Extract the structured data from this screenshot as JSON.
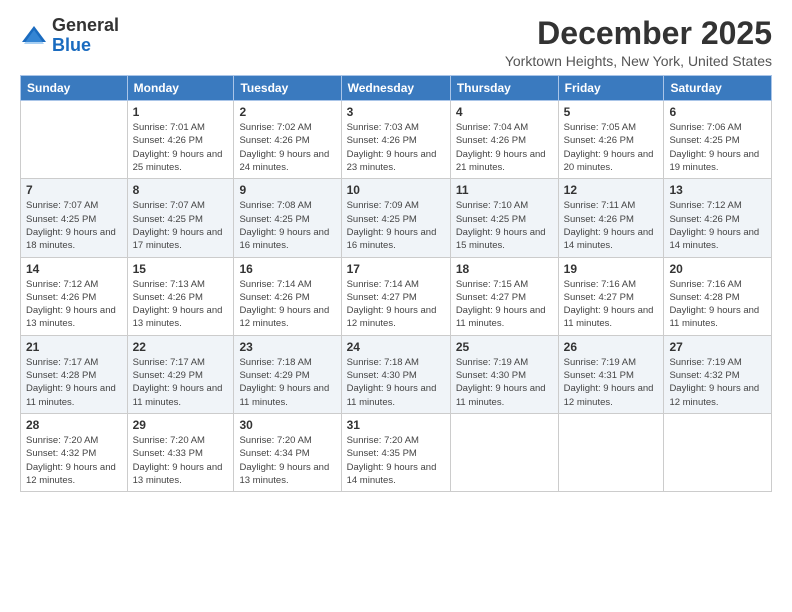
{
  "logo": {
    "general": "General",
    "blue": "Blue"
  },
  "title": "December 2025",
  "subtitle": "Yorktown Heights, New York, United States",
  "weekdays": [
    "Sunday",
    "Monday",
    "Tuesday",
    "Wednesday",
    "Thursday",
    "Friday",
    "Saturday"
  ],
  "weeks": [
    [
      {
        "day": "",
        "sunrise": "",
        "sunset": "",
        "daylight": ""
      },
      {
        "day": "1",
        "sunrise": "Sunrise: 7:01 AM",
        "sunset": "Sunset: 4:26 PM",
        "daylight": "Daylight: 9 hours and 25 minutes."
      },
      {
        "day": "2",
        "sunrise": "Sunrise: 7:02 AM",
        "sunset": "Sunset: 4:26 PM",
        "daylight": "Daylight: 9 hours and 24 minutes."
      },
      {
        "day": "3",
        "sunrise": "Sunrise: 7:03 AM",
        "sunset": "Sunset: 4:26 PM",
        "daylight": "Daylight: 9 hours and 23 minutes."
      },
      {
        "day": "4",
        "sunrise": "Sunrise: 7:04 AM",
        "sunset": "Sunset: 4:26 PM",
        "daylight": "Daylight: 9 hours and 21 minutes."
      },
      {
        "day": "5",
        "sunrise": "Sunrise: 7:05 AM",
        "sunset": "Sunset: 4:26 PM",
        "daylight": "Daylight: 9 hours and 20 minutes."
      },
      {
        "day": "6",
        "sunrise": "Sunrise: 7:06 AM",
        "sunset": "Sunset: 4:25 PM",
        "daylight": "Daylight: 9 hours and 19 minutes."
      }
    ],
    [
      {
        "day": "7",
        "sunrise": "Sunrise: 7:07 AM",
        "sunset": "Sunset: 4:25 PM",
        "daylight": "Daylight: 9 hours and 18 minutes."
      },
      {
        "day": "8",
        "sunrise": "Sunrise: 7:07 AM",
        "sunset": "Sunset: 4:25 PM",
        "daylight": "Daylight: 9 hours and 17 minutes."
      },
      {
        "day": "9",
        "sunrise": "Sunrise: 7:08 AM",
        "sunset": "Sunset: 4:25 PM",
        "daylight": "Daylight: 9 hours and 16 minutes."
      },
      {
        "day": "10",
        "sunrise": "Sunrise: 7:09 AM",
        "sunset": "Sunset: 4:25 PM",
        "daylight": "Daylight: 9 hours and 16 minutes."
      },
      {
        "day": "11",
        "sunrise": "Sunrise: 7:10 AM",
        "sunset": "Sunset: 4:25 PM",
        "daylight": "Daylight: 9 hours and 15 minutes."
      },
      {
        "day": "12",
        "sunrise": "Sunrise: 7:11 AM",
        "sunset": "Sunset: 4:26 PM",
        "daylight": "Daylight: 9 hours and 14 minutes."
      },
      {
        "day": "13",
        "sunrise": "Sunrise: 7:12 AM",
        "sunset": "Sunset: 4:26 PM",
        "daylight": "Daylight: 9 hours and 14 minutes."
      }
    ],
    [
      {
        "day": "14",
        "sunrise": "Sunrise: 7:12 AM",
        "sunset": "Sunset: 4:26 PM",
        "daylight": "Daylight: 9 hours and 13 minutes."
      },
      {
        "day": "15",
        "sunrise": "Sunrise: 7:13 AM",
        "sunset": "Sunset: 4:26 PM",
        "daylight": "Daylight: 9 hours and 13 minutes."
      },
      {
        "day": "16",
        "sunrise": "Sunrise: 7:14 AM",
        "sunset": "Sunset: 4:26 PM",
        "daylight": "Daylight: 9 hours and 12 minutes."
      },
      {
        "day": "17",
        "sunrise": "Sunrise: 7:14 AM",
        "sunset": "Sunset: 4:27 PM",
        "daylight": "Daylight: 9 hours and 12 minutes."
      },
      {
        "day": "18",
        "sunrise": "Sunrise: 7:15 AM",
        "sunset": "Sunset: 4:27 PM",
        "daylight": "Daylight: 9 hours and 11 minutes."
      },
      {
        "day": "19",
        "sunrise": "Sunrise: 7:16 AM",
        "sunset": "Sunset: 4:27 PM",
        "daylight": "Daylight: 9 hours and 11 minutes."
      },
      {
        "day": "20",
        "sunrise": "Sunrise: 7:16 AM",
        "sunset": "Sunset: 4:28 PM",
        "daylight": "Daylight: 9 hours and 11 minutes."
      }
    ],
    [
      {
        "day": "21",
        "sunrise": "Sunrise: 7:17 AM",
        "sunset": "Sunset: 4:28 PM",
        "daylight": "Daylight: 9 hours and 11 minutes."
      },
      {
        "day": "22",
        "sunrise": "Sunrise: 7:17 AM",
        "sunset": "Sunset: 4:29 PM",
        "daylight": "Daylight: 9 hours and 11 minutes."
      },
      {
        "day": "23",
        "sunrise": "Sunrise: 7:18 AM",
        "sunset": "Sunset: 4:29 PM",
        "daylight": "Daylight: 9 hours and 11 minutes."
      },
      {
        "day": "24",
        "sunrise": "Sunrise: 7:18 AM",
        "sunset": "Sunset: 4:30 PM",
        "daylight": "Daylight: 9 hours and 11 minutes."
      },
      {
        "day": "25",
        "sunrise": "Sunrise: 7:19 AM",
        "sunset": "Sunset: 4:30 PM",
        "daylight": "Daylight: 9 hours and 11 minutes."
      },
      {
        "day": "26",
        "sunrise": "Sunrise: 7:19 AM",
        "sunset": "Sunset: 4:31 PM",
        "daylight": "Daylight: 9 hours and 12 minutes."
      },
      {
        "day": "27",
        "sunrise": "Sunrise: 7:19 AM",
        "sunset": "Sunset: 4:32 PM",
        "daylight": "Daylight: 9 hours and 12 minutes."
      }
    ],
    [
      {
        "day": "28",
        "sunrise": "Sunrise: 7:20 AM",
        "sunset": "Sunset: 4:32 PM",
        "daylight": "Daylight: 9 hours and 12 minutes."
      },
      {
        "day": "29",
        "sunrise": "Sunrise: 7:20 AM",
        "sunset": "Sunset: 4:33 PM",
        "daylight": "Daylight: 9 hours and 13 minutes."
      },
      {
        "day": "30",
        "sunrise": "Sunrise: 7:20 AM",
        "sunset": "Sunset: 4:34 PM",
        "daylight": "Daylight: 9 hours and 13 minutes."
      },
      {
        "day": "31",
        "sunrise": "Sunrise: 7:20 AM",
        "sunset": "Sunset: 4:35 PM",
        "daylight": "Daylight: 9 hours and 14 minutes."
      },
      {
        "day": "",
        "sunrise": "",
        "sunset": "",
        "daylight": ""
      },
      {
        "day": "",
        "sunrise": "",
        "sunset": "",
        "daylight": ""
      },
      {
        "day": "",
        "sunrise": "",
        "sunset": "",
        "daylight": ""
      }
    ]
  ]
}
